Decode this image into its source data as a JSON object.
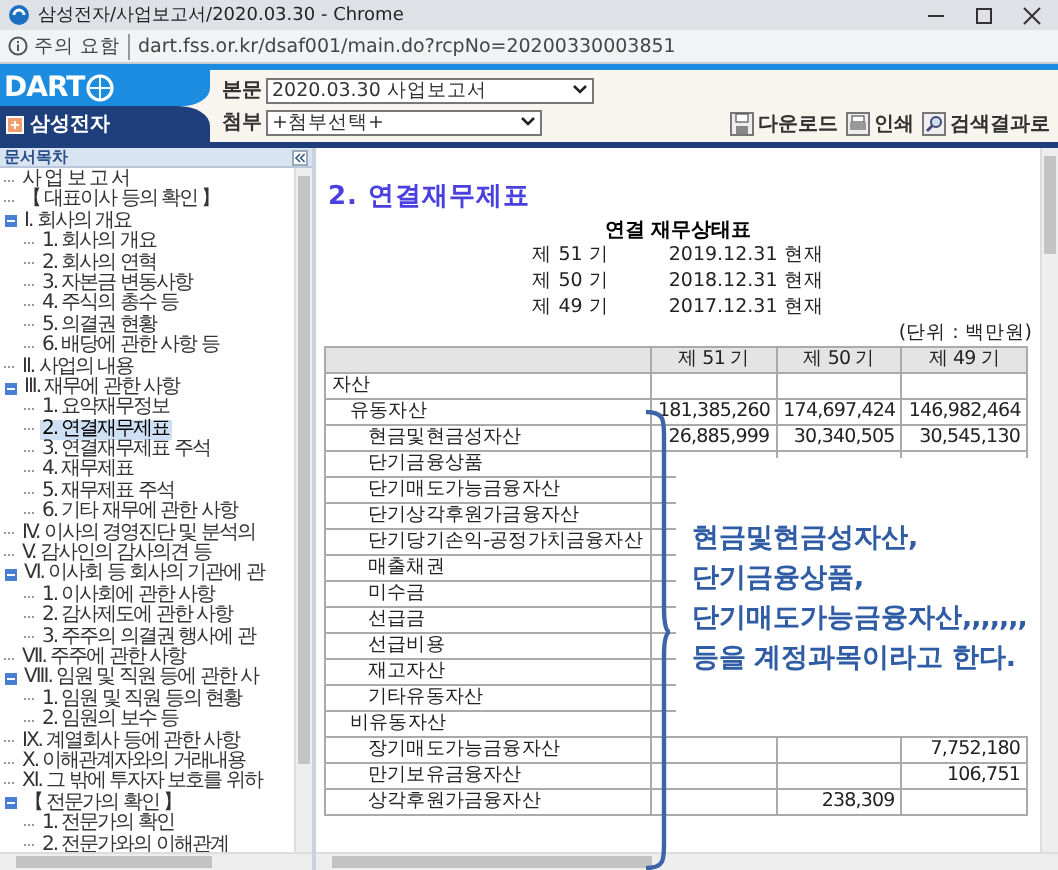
{
  "window": {
    "title": "삼성전자/사업보고서/2020.03.30 - Chrome"
  },
  "address_bar": {
    "security": "주의 요함",
    "url": "dart.fss.or.kr/dsaf001/main.do?rcpNo=20200330003851"
  },
  "header": {
    "logo": "DART",
    "company": "삼성전자",
    "fields": [
      {
        "label": "본문",
        "value": "2020.03.30  사업보고서"
      },
      {
        "label": "첨부",
        "value": "+첨부선택+"
      }
    ],
    "buttons": [
      {
        "label": "다운로드",
        "kind": "download"
      },
      {
        "label": "인쇄",
        "kind": "print"
      },
      {
        "label": "검색결과로",
        "kind": "search"
      }
    ]
  },
  "sidebar": {
    "title": "문서목차",
    "items": [
      {
        "label": "사 업 보 고 서",
        "selected": false
      },
      {
        "label": "【 대표이사 등의 확인 】",
        "selected": false
      },
      {
        "label": "I. 회사의 개요",
        "selected": false,
        "expanded": true,
        "children": [
          {
            "label": "1. 회사의 개요",
            "selected": false
          },
          {
            "label": "2. 회사의 연혁",
            "selected": false
          },
          {
            "label": "3. 자본금 변동사항",
            "selected": false
          },
          {
            "label": "4. 주식의 총수 등",
            "selected": false
          },
          {
            "label": "5. 의결권 현황",
            "selected": false
          },
          {
            "label": "6. 배당에 관한 사항 등",
            "selected": false
          }
        ]
      },
      {
        "label": "II. 사업의 내용",
        "selected": false
      },
      {
        "label": "III. 재무에 관한 사항",
        "selected": false,
        "expanded": true,
        "children": [
          {
            "label": "1. 요약재무정보",
            "selected": false
          },
          {
            "label": "2. 연결재무제표",
            "selected": true
          },
          {
            "label": "3. 연결재무제표 주석",
            "selected": false
          },
          {
            "label": "4. 재무제표",
            "selected": false
          },
          {
            "label": "5. 재무제표 주석",
            "selected": false
          },
          {
            "label": "6. 기타 재무에 관한 사항",
            "selected": false
          }
        ]
      },
      {
        "label": "IV. 이사의 경영진단 및 분석의",
        "selected": false
      },
      {
        "label": "V. 감사인의 감사의견 등",
        "selected": false
      },
      {
        "label": "VI. 이사회 등 회사의 기관에 관",
        "selected": false,
        "expanded": true,
        "children": [
          {
            "label": "1. 이사회에 관한 사항",
            "selected": false
          },
          {
            "label": "2. 감사제도에 관한 사항",
            "selected": false
          },
          {
            "label": "3. 주주의 의결권 행사에 관",
            "selected": false
          }
        ]
      },
      {
        "label": "VII. 주주에 관한 사항",
        "selected": false
      },
      {
        "label": "VIII. 임원 및 직원 등에 관한 사",
        "selected": false,
        "expanded": true,
        "children": [
          {
            "label": "1. 임원 및 직원 등의 현황",
            "selected": false
          },
          {
            "label": "2. 임원의 보수 등",
            "selected": false
          }
        ]
      },
      {
        "label": "IX. 계열회사 등에 관한 사항",
        "selected": false
      },
      {
        "label": "X. 이해관계자와의 거래내용",
        "selected": false
      },
      {
        "label": "XI. 그 밖에 투자자 보호를 위하",
        "selected": false
      },
      {
        "label": "【 전문가의 확인 】",
        "selected": false,
        "expanded": true,
        "children": [
          {
            "label": "1. 전문가의 확인",
            "selected": false
          },
          {
            "label": "2. 전문가와의 이해관계",
            "selected": false
          }
        ]
      }
    ]
  },
  "content": {
    "heading": "2. 연결재무제표",
    "statement_title": "연결 재무상태표",
    "periods": [
      {
        "term": "제 51 기",
        "date": "2019.12.31 현재"
      },
      {
        "term": "제 50 기",
        "date": "2018.12.31 현재"
      },
      {
        "term": "제 49 기",
        "date": "2017.12.31 현재"
      }
    ],
    "unit": "(단위 : 백만원)",
    "table": {
      "columns": [
        "제 51 기",
        "제 50 기",
        "제 49 기"
      ],
      "rows": [
        {
          "label": "자산",
          "children": [
            {
              "label": "유동자산",
              "values": {
                "col_1": "181,385,260",
                "col_2": "174,697,424",
                "col_3": "146,982,464"
              },
              "children": [
                {
                  "label": "현금및현금성자산",
                  "values": {
                    "col_1": "26,885,999",
                    "col_2": "30,340,505",
                    "col_3": "30,545,130"
                  }
                },
                {
                  "label": "단기금융상품"
                },
                {
                  "label": "단기매도가능금융자산"
                },
                {
                  "label": "단기상각후원가금융자산"
                },
                {
                  "label": "단기당기손익-공정가치금융자산"
                },
                {
                  "label": "매출채권"
                },
                {
                  "label": "미수금"
                },
                {
                  "label": "선급금"
                },
                {
                  "label": "선급비용"
                },
                {
                  "label": "재고자산"
                },
                {
                  "label": "기타유동자산"
                }
              ]
            },
            {
              "label": "비유동자산",
              "children": [
                {
                  "label": "장기매도가능금융자산",
                  "values": {
                    "col_3": "7,752,180"
                  }
                },
                {
                  "label": "만기보유금융자산",
                  "values": {
                    "col_3": "106,751"
                  }
                },
                {
                  "label": "상각후원가금융자산",
                  "values": {
                    "col_2": "238,309"
                  }
                }
              ]
            }
          ]
        }
      ]
    }
  },
  "annotation": {
    "lines": [
      "현금및현금성자산,",
      "단기금융상품,",
      "단기매도가능금융자산,,,,,,,",
      "등을 계정과목이라고 한다."
    ]
  }
}
